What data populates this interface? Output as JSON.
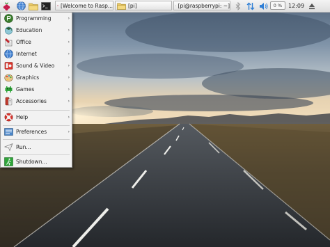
{
  "taskbar": {
    "menu_button_icon": "raspberry-logo-icon",
    "launchers": [
      "globe-browser-icon",
      "file-manager-icon",
      "terminal-icon"
    ],
    "tasks": [
      {
        "label": "[Welcome to Rasp...",
        "icon": "raspberry-logo-icon"
      },
      {
        "label": "[pi]",
        "icon": "folder-icon"
      },
      {
        "label": "[pi@raspberrypi: ~]",
        "icon": "terminal-icon"
      }
    ],
    "tray": {
      "bluetooth_icon": "bluetooth-icon",
      "network_icon": "network-updown-icon",
      "volume_icon": "speaker-icon",
      "volume_label": "0 %",
      "clock": "12:09",
      "eject_icon": "eject-icon"
    }
  },
  "menu": {
    "items": [
      {
        "label": "Programming",
        "icon": "programming-icon",
        "submenu": true
      },
      {
        "label": "Education",
        "icon": "education-icon",
        "submenu": true
      },
      {
        "label": "Office",
        "icon": "office-icon",
        "submenu": true
      },
      {
        "label": "Internet",
        "icon": "internet-globe-icon",
        "submenu": true
      },
      {
        "label": "Sound & Video",
        "icon": "sound-video-icon",
        "submenu": true
      },
      {
        "label": "Graphics",
        "icon": "graphics-icon",
        "submenu": true
      },
      {
        "label": "Games",
        "icon": "games-icon",
        "submenu": true
      },
      {
        "label": "Accessories",
        "icon": "accessories-icon",
        "submenu": true
      },
      {
        "label": "Help",
        "icon": "help-lifebuoy-icon",
        "submenu": true
      },
      {
        "label": "Preferences",
        "icon": "preferences-icon",
        "submenu": true
      },
      {
        "label": "Run...",
        "icon": "run-icon",
        "submenu": false
      },
      {
        "label": "Shutdown...",
        "icon": "shutdown-exit-icon",
        "submenu": false
      }
    ],
    "submenu_arrow": "›"
  },
  "colors": {
    "panel": "#e8e8e8",
    "menu_bg": "#f2f2f2",
    "raspberry": "#c51a4a",
    "sky_top": "#5a6e85",
    "sunset": "#f0d8b0",
    "road": "#2f3338"
  }
}
